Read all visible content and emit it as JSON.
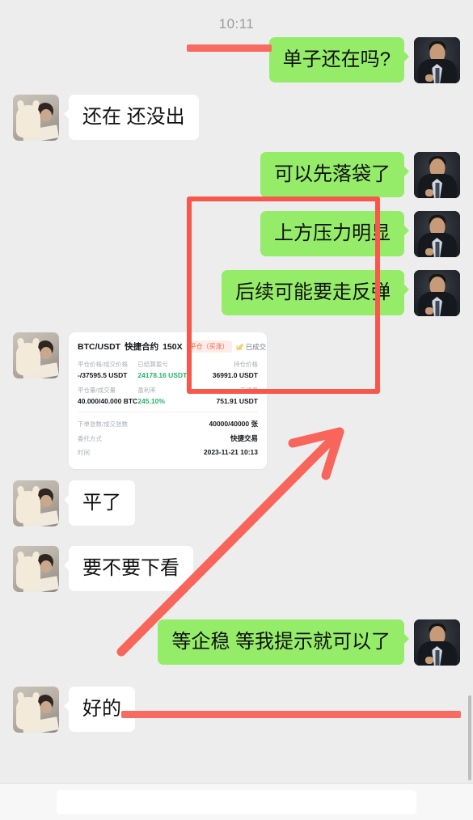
{
  "app": {
    "background_color": "#ededed",
    "bubble_green": "#95ec69",
    "bubble_white": "#ffffff",
    "annotation_color": "#f8584b"
  },
  "timestamp": "10:11",
  "messages": [
    {
      "id": "m1",
      "side": "right",
      "text": "单子还在吗?",
      "avatar": "suit-avatar"
    },
    {
      "id": "m2",
      "side": "left",
      "text": "还在 还没出",
      "avatar": "plush-avatar"
    },
    {
      "id": "m3",
      "side": "right",
      "text": "可以先落袋了",
      "avatar": "suit-avatar"
    },
    {
      "id": "m4",
      "side": "right",
      "text": "上方压力明显",
      "avatar": "suit-avatar"
    },
    {
      "id": "m5",
      "side": "right",
      "text": "后续可能要走反弹",
      "avatar": "suit-avatar"
    },
    {
      "id": "m6",
      "side": "left",
      "text": "平了",
      "avatar": "plush-avatar"
    },
    {
      "id": "m7",
      "side": "left",
      "text": "要不要下看",
      "avatar": "plush-avatar"
    },
    {
      "id": "m8",
      "side": "right",
      "text": "等企稳 等我提示就可以了",
      "avatar": "suit-avatar"
    },
    {
      "id": "m9",
      "side": "left",
      "text": "好的",
      "avatar": "plush-avatar"
    }
  ],
  "trade_card": {
    "pair": "BTC/USDT",
    "contract_type": "快捷合约",
    "leverage": "150X",
    "badge": "平仓（买涨）",
    "status": "已成交",
    "status_icon": "edit-square-icon",
    "rows": [
      {
        "label_1": "平仓价格/成交价格",
        "value_1": "-/37595.5 USDT",
        "label_2": "已结算盈亏",
        "value_2": "24178.16 USDT",
        "value_2_color": "#23b26d",
        "label_3": "持仓价格",
        "value_3": "36991.0 USDT"
      },
      {
        "label_1": "平仓量/成交量",
        "value_1": "40.000/40.000 BTC",
        "label_2": "盈利率",
        "value_2": "245.10%",
        "value_2_color": "#23b26d",
        "label_3": "手续费",
        "value_3": "751.91 USDT"
      }
    ],
    "details": [
      {
        "key": "下单张数/成交张数",
        "value": "40000/40000 张"
      },
      {
        "key": "委托方式",
        "value": "快捷交易"
      },
      {
        "key": "时间",
        "value": "2023-11-21 10:13"
      }
    ]
  },
  "annotations": [
    {
      "id": "a1",
      "type": "underline-bar",
      "target": "timestamp"
    },
    {
      "id": "a2",
      "type": "rectangle",
      "target": "advice-messages-group"
    },
    {
      "id": "a3",
      "type": "arrow",
      "target": "trade-card"
    },
    {
      "id": "a4",
      "type": "underline-bar",
      "target": "final-instruction-message"
    }
  ]
}
